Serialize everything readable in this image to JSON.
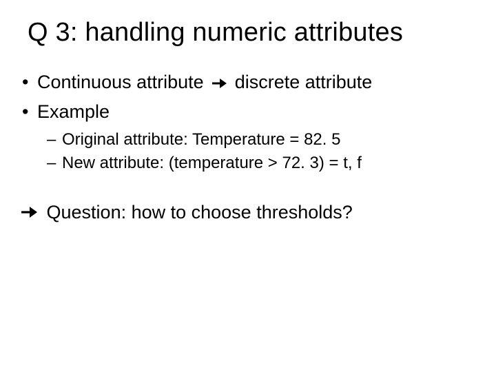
{
  "title": "Q 3: handling numeric attributes",
  "bullets": {
    "b1a_pre": "Continuous attribute",
    "b1a_post": "discrete attribute",
    "b2": "Example",
    "sub1": "Original attribute: Temperature = 82. 5",
    "sub2": "New attribute: (temperature > 72. 3) = t, f"
  },
  "question": "Question: how to choose thresholds?"
}
